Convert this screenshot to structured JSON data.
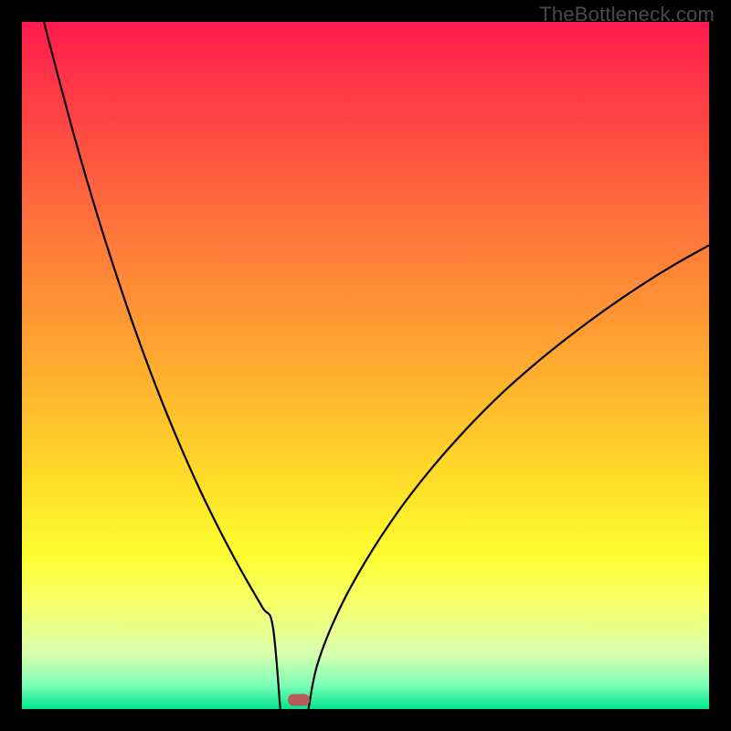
{
  "watermark": {
    "text": "TheBottleneck.com"
  },
  "chart_data": {
    "type": "line",
    "title": "",
    "xlabel": "",
    "ylabel": "",
    "xlim": [
      0,
      100
    ],
    "ylim": [
      0,
      100
    ],
    "grid": false,
    "curve_left": {
      "x": [
        3.19,
        5,
        8,
        11,
        14,
        17,
        20,
        23,
        26,
        29,
        32,
        35,
        36.5,
        37.6
      ],
      "y": [
        100,
        93.1,
        82.0,
        71.8,
        62.4,
        53.7,
        45.7,
        38.4,
        31.7,
        25.6,
        20.0,
        14.8,
        12.1,
        0
      ]
    },
    "curve_right": {
      "x": [
        41.7,
        43,
        46,
        50,
        55,
        60,
        65,
        70,
        75,
        80,
        85,
        90,
        95,
        100
      ],
      "y": [
        0,
        6.5,
        14.1,
        21.5,
        29.1,
        35.5,
        41.1,
        46.1,
        50.5,
        54.5,
        58.2,
        61.6,
        64.7,
        67.5
      ]
    },
    "marker_xy": [
      40.3,
      1.3
    ]
  },
  "colors": {
    "curve_stroke": "#000000",
    "marker_fill": "#b85a5a",
    "frame": "#000000"
  }
}
